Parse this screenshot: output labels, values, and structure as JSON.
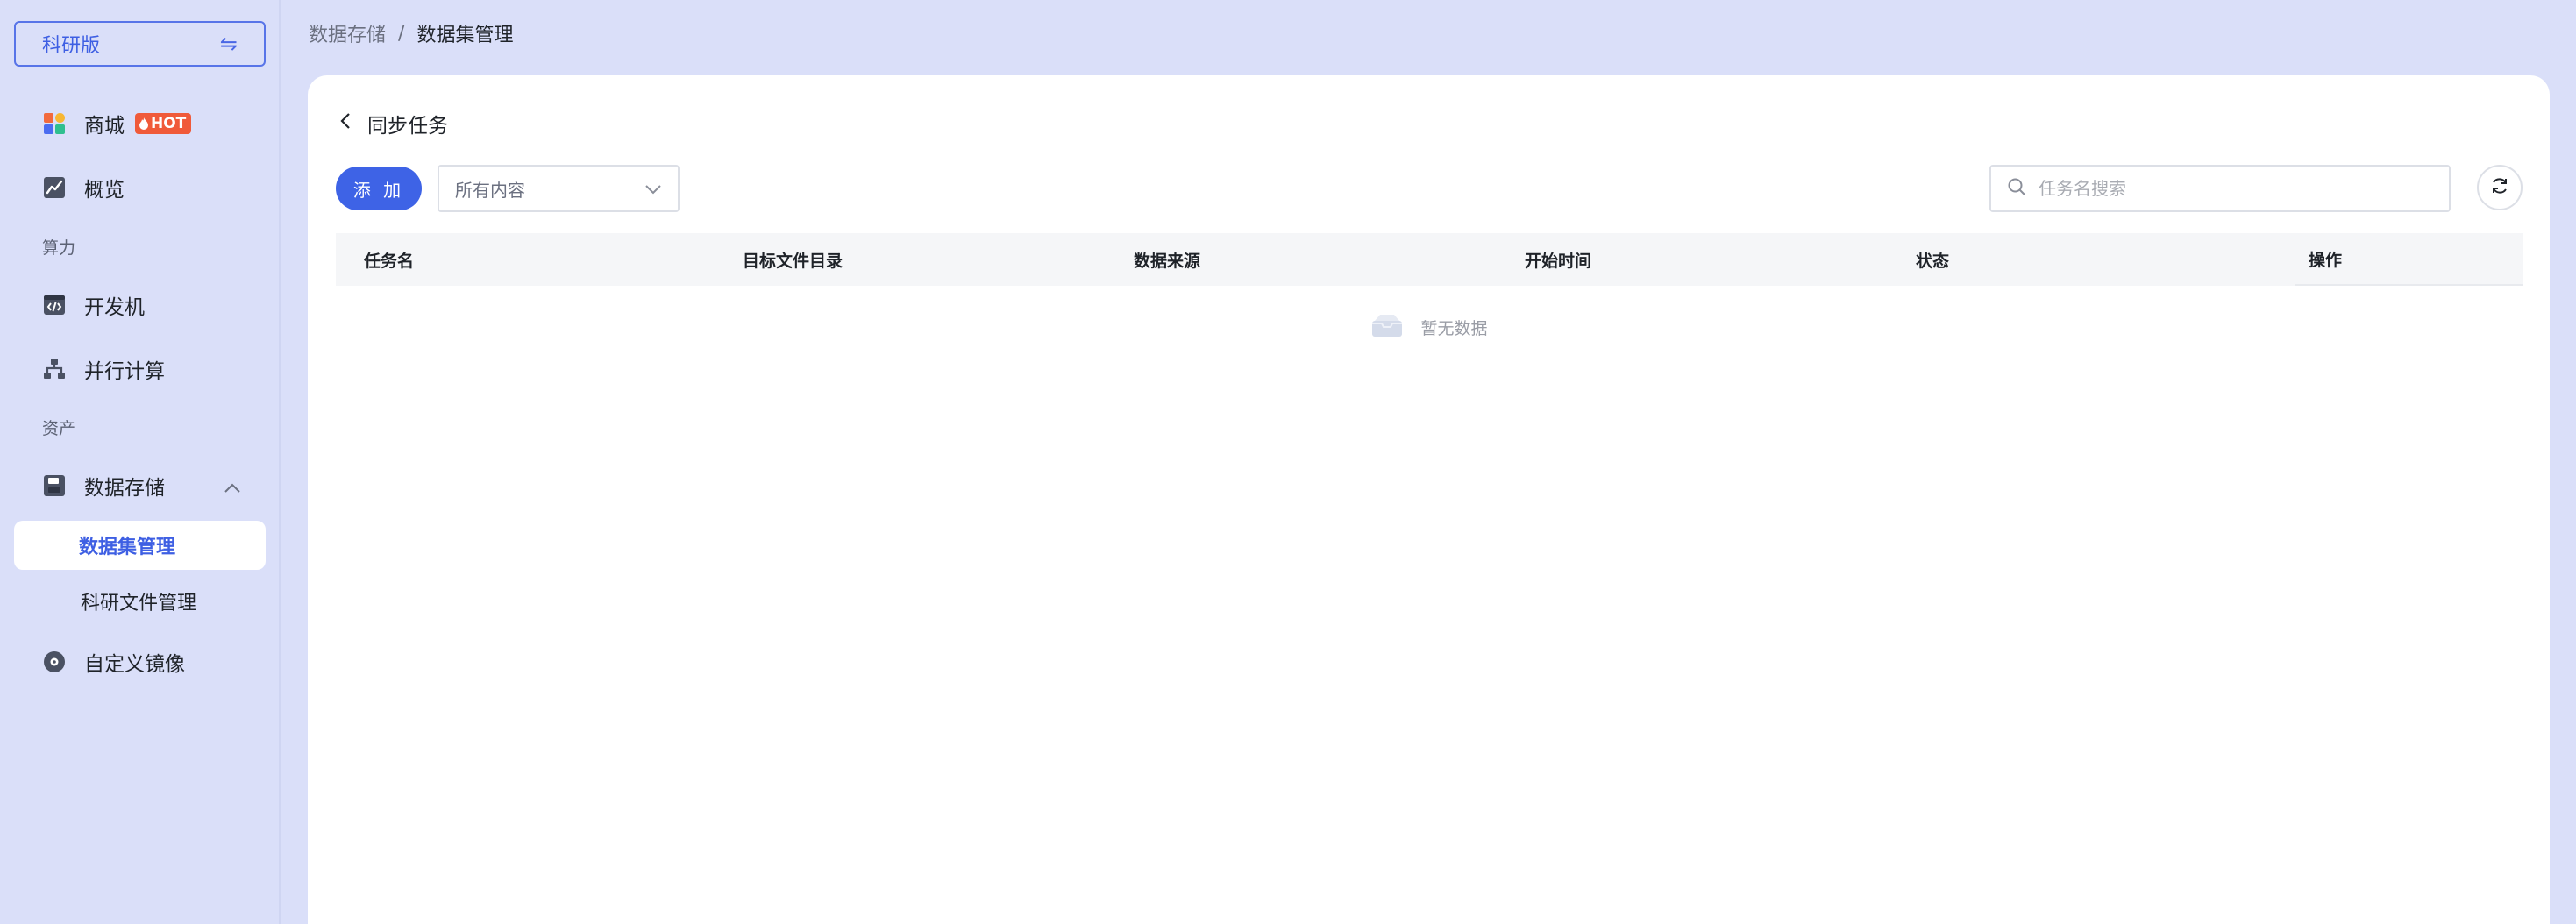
{
  "sidebar": {
    "edition_label": "科研版",
    "edition_switch_icon": "⇋",
    "items": [
      {
        "label": "商城",
        "icon": "store-icon",
        "badge": "HOT"
      },
      {
        "label": "概览",
        "icon": "chart-icon"
      },
      {
        "group": "算力"
      },
      {
        "label": "开发机",
        "icon": "code-icon"
      },
      {
        "label": "并行计算",
        "icon": "cluster-icon"
      },
      {
        "group": "资产"
      },
      {
        "label": "数据存储",
        "icon": "storage-icon",
        "expanded": true,
        "children": [
          {
            "label": "数据集管理",
            "active": true
          },
          {
            "label": "科研文件管理"
          }
        ]
      },
      {
        "label": "自定义镜像",
        "icon": "image-icon"
      }
    ]
  },
  "breadcrumb": {
    "parent": "数据存储",
    "separator": "/",
    "current": "数据集管理"
  },
  "page": {
    "title": "同步任务",
    "add_button": "添 加",
    "filter_select": "所有内容",
    "search_placeholder": "任务名搜索"
  },
  "table": {
    "columns": [
      "任务名",
      "目标文件目录",
      "数据来源",
      "开始时间",
      "状态",
      "操作"
    ],
    "rows": [],
    "empty_text": "暂无数据"
  },
  "colors": {
    "accent": "#3e63e6",
    "background": "#dadff9",
    "hot_badge": "#f05a3a"
  }
}
